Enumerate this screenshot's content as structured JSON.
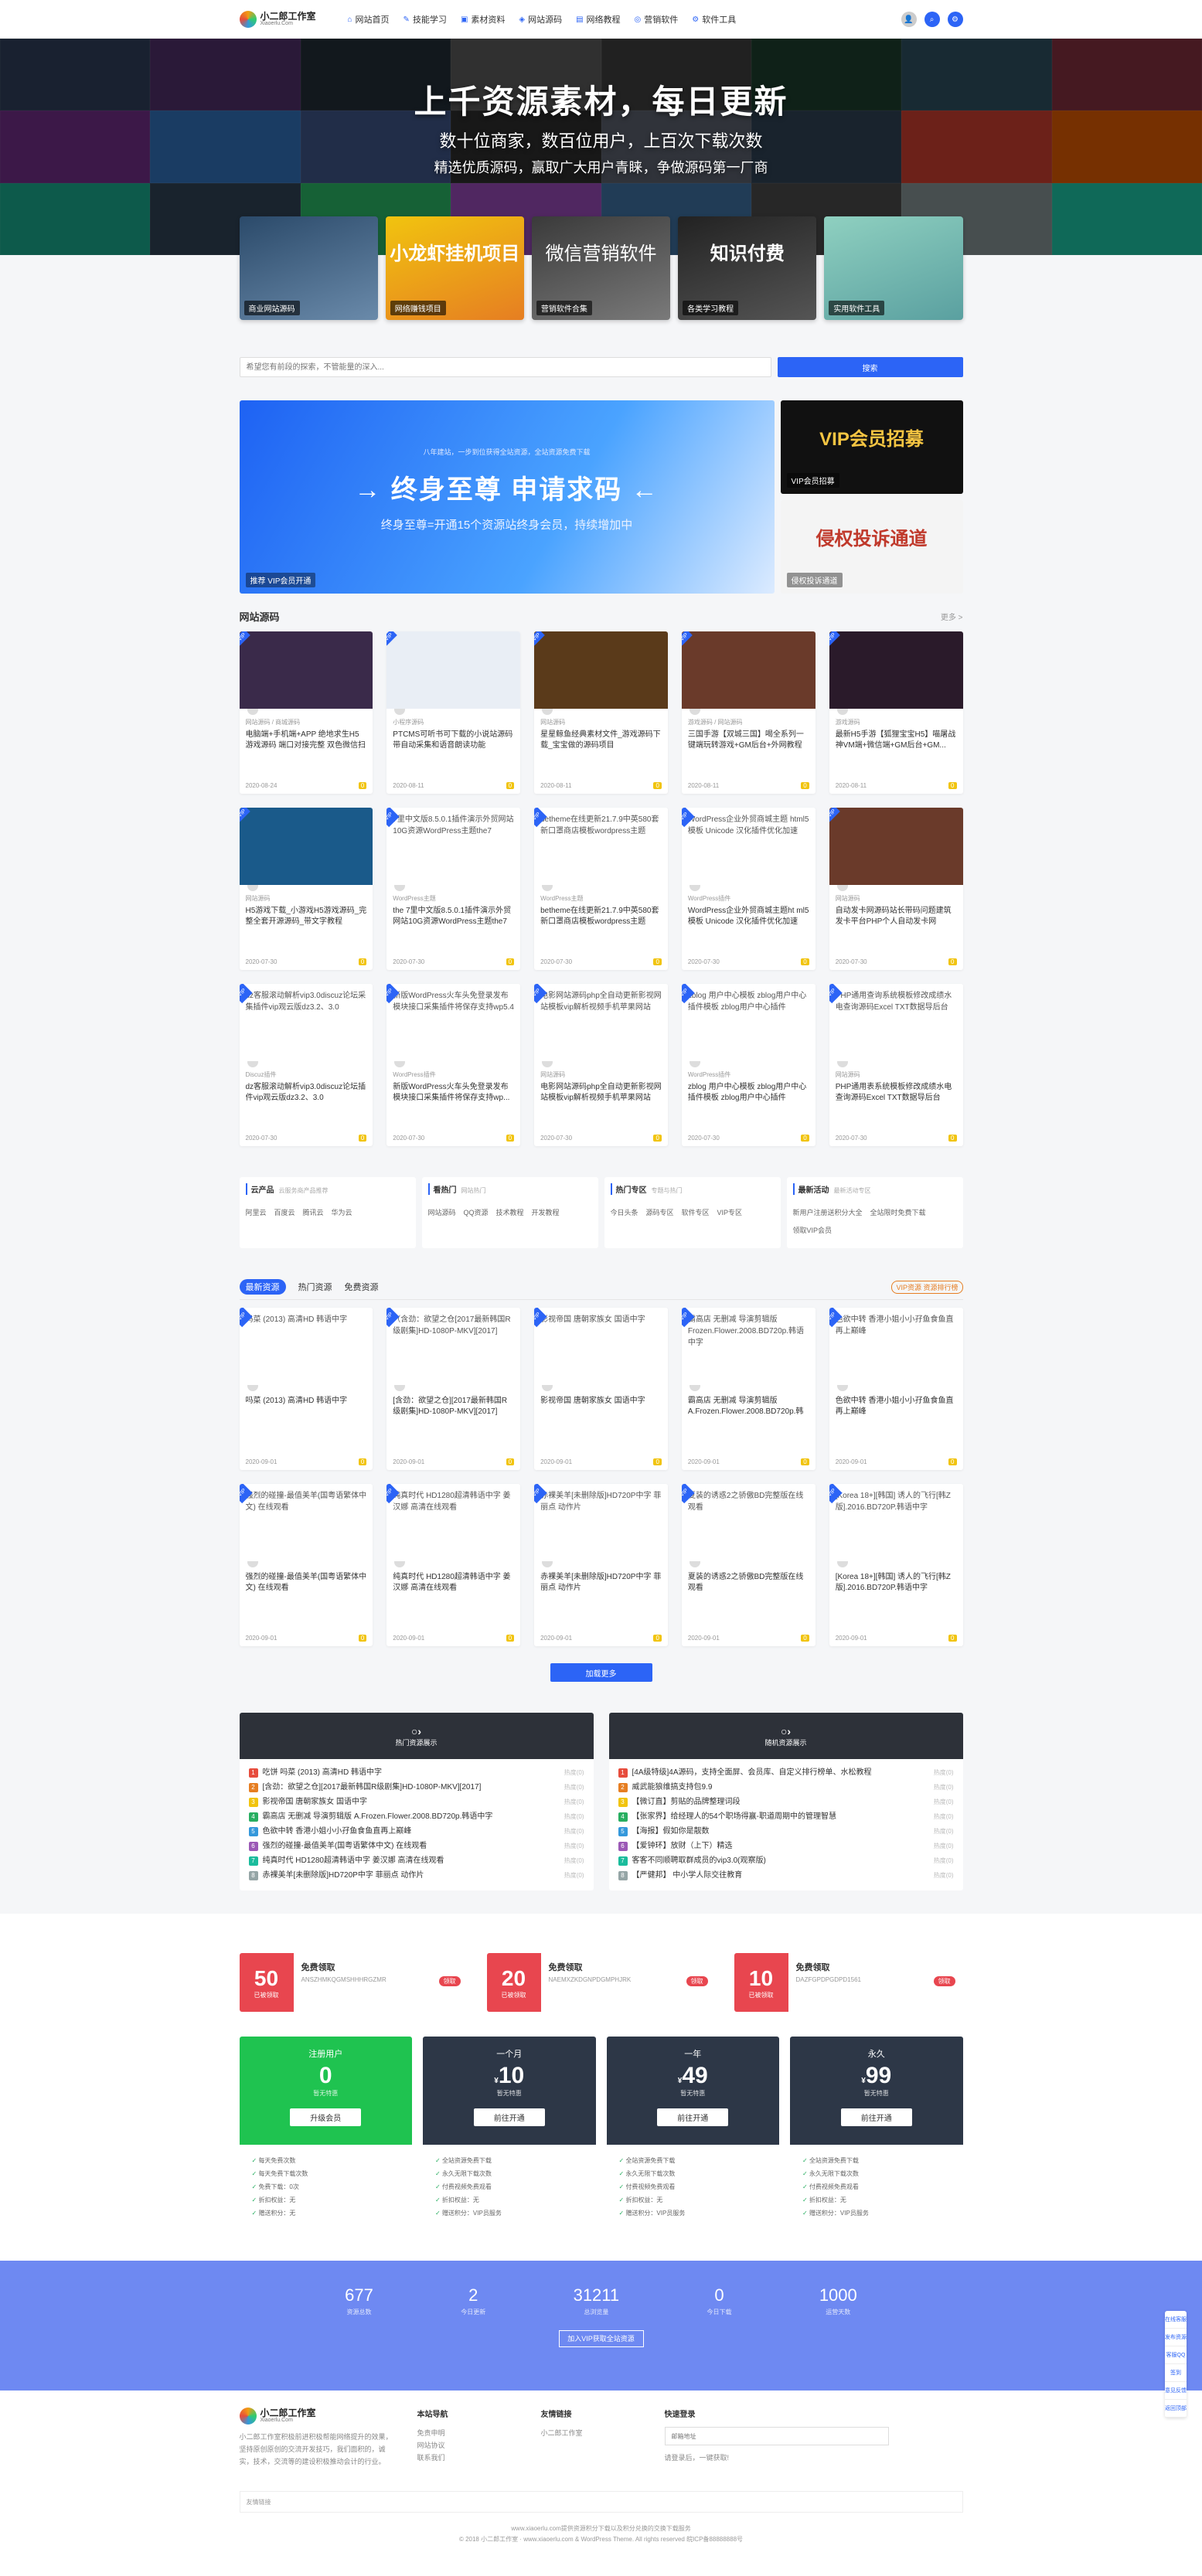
{
  "header": {
    "logo_text": "小二郎工作室",
    "logo_sub": "Xiaoerlu.Com",
    "nav": [
      "网站首页",
      "技能学习",
      "素材资料",
      "网站源码",
      "网络教程",
      "营销软件",
      "软件工具"
    ],
    "colors": {
      "accent": "#2c64f6"
    }
  },
  "hero": {
    "title": "上千资源素材，每日更新",
    "sub": "数十位商家，数百位用户，上百次下载次数",
    "sub2": "精选优质源码，赢取广大用户青睐，争做源码第一厂商"
  },
  "categories": [
    {
      "label": "商业网站源码"
    },
    {
      "label": "网络赚钱项目",
      "big": "小龙虾挂机项目"
    },
    {
      "label": "营销软件合集",
      "big": "微信营销软件"
    },
    {
      "label": "各类学习教程",
      "big": "知识付费"
    },
    {
      "label": "实用软件工具"
    }
  ],
  "search": {
    "placeholder": "希望您有前段的探索，不管能量的深入...",
    "button": "搜索"
  },
  "banner": {
    "small_text": "八年建站，一步到位获得全站资源，全站资源免费下载",
    "title": "→ 终身至尊 申请求码 ←",
    "sub": "终身至尊=开通15个资源站终身会员，持续增加中",
    "tag": "推荐  VIP会员开通",
    "side1_big": "VIP会员招募",
    "side1_tag": "VIP会员招募",
    "side2_big": "侵权投诉通道",
    "side2_tag": "侵权投诉通道"
  },
  "section1": {
    "title": "网站源码",
    "more": "更多 >"
  },
  "cards": [
    {
      "meta": "网站源码 / 商城源码",
      "title": "电脑端+手机端+APP 绝地求生H5游戏源码 端口对接完整 双色微信扫码",
      "date": "2020-08-24",
      "tag": "0"
    },
    {
      "meta": "小程序源码",
      "title": "PTCMS可听书可下载的小说站源码 带自动采集和语音朗读功能",
      "date": "2020-08-11",
      "tag": "0"
    },
    {
      "meta": "网站源码",
      "title": "星星鲸鱼经典素材文件_游戏源码下载_宝宝做的源码项目",
      "date": "2020-08-11",
      "tag": "0"
    },
    {
      "meta": "游戏源码 / 网站源码",
      "title": "三国手游【双城三国】喝全系列一键端玩转游戏+GM后台+外网教程",
      "date": "2020-08-11",
      "tag": "0"
    },
    {
      "meta": "游戏源码",
      "title": "最新H5手游【狐狸宝宝H5】喵屠战神VM端+微信端+GM后台+GM...",
      "date": "2020-08-11",
      "tag": "0"
    },
    {
      "meta": "网站源码",
      "title": "H5游戏下载_小游戏H5游戏源码_完整全套开源源码_带文字教程",
      "date": "2020-07-30",
      "tag": "0"
    },
    {
      "meta": "WordPress主题",
      "title": "the 7里中文版8.5.0.1插件演示外贸网站10G资源WordPress主题the7",
      "date": "2020-07-30",
      "tag": "0",
      "text": "7里中文版8.5.0.1插件演示外贸网站10G资源WordPress主题the7"
    },
    {
      "meta": "WordPress主题",
      "title": "betheme在线更新21.7.9中英580套 新口罩商店模板wordpress主题",
      "date": "2020-07-30",
      "tag": "0",
      "text": "betheme在线更新21.7.9中英580套新口罩商店模板wordpress主题"
    },
    {
      "meta": "WordPress插件",
      "title": "WordPress企业外贸商城主题ht ml5模板 Unicode 汉化插件优化加速",
      "date": "2020-07-30",
      "tag": "0",
      "text": "WordPress企业外贸商城主题 html5模板 Unicode 汉化插件优化加速"
    },
    {
      "meta": "网站源码",
      "title": "自动发卡网源码站长带码问题建筑 发卡平台PHP个人自动发卡网",
      "date": "2020-07-30",
      "tag": "0"
    },
    {
      "meta": "Discuz插件",
      "title": "dz客服滚动解析vip3.0discuz论坛插件vip观云版dz3.2、3.0",
      "date": "2020-07-30",
      "tag": "0",
      "text": "dz客服滚动解析vip3.0discuz论坛采集插件vip观云版dz3.2、3.0"
    },
    {
      "meta": "WordPress插件",
      "title": "新版WordPress火车头免登录发布模块接口采集插件将保存支持wp...",
      "date": "2020-07-30",
      "tag": "0",
      "text": "新版WordPress火车头免登录发布模块接口采集插件将保存支持wp5.4"
    },
    {
      "meta": "网站源码",
      "title": "电影网站源码php全自动更新影视网站模板vip解析视频手机苹果网站",
      "date": "2020-07-30",
      "tag": "0",
      "text": "电影网站源码php全自动更新影视网站模板vip解析视频手机苹果网站"
    },
    {
      "meta": "WordPress插件",
      "title": "zblog 用户中心模板 zblog用户中心插件模板 zblog用户中心插件",
      "date": "2020-07-30",
      "tag": "0",
      "text": "zblog 用户中心模板 zblog用户中心插件模板 zblog用户中心插件"
    },
    {
      "meta": "网站源码",
      "title": "PHP通用表系统模板修改成绩水电查询源码Excel TXT数据导后台",
      "date": "2020-07-30",
      "tag": "0",
      "text": "PHP通用查询系统模板修改成绩水电查询源码Excel TXT数据导后台"
    }
  ],
  "links": [
    {
      "title": "云产品",
      "sub": "云服务商产品推荐",
      "items": [
        "阿里云",
        "百度云",
        "腾讯云",
        "华为云"
      ]
    },
    {
      "title": "看热门",
      "sub": "网站热门",
      "items": [
        "网站源码",
        "QQ资源",
        "技术教程",
        "开发教程"
      ]
    },
    {
      "title": "热门专区",
      "sub": "专题与热门",
      "items": [
        "今日头条",
        "源码专区",
        "软件专区",
        "VIP专区"
      ]
    },
    {
      "title": "最新活动",
      "sub": "最新活动专区",
      "items": [
        "新用户注册送积分大全",
        "全站限时免费下载",
        "领取VIP会员"
      ]
    }
  ],
  "tabs": {
    "items": [
      "最新资源",
      "热门资源",
      "免费资源"
    ],
    "rank": "VIP资源 资源排行榜"
  },
  "cards2": [
    {
      "text": "吗菜 (2013) 高清HD 韩语中字",
      "title": "吗菜 (2013) 高清HD 韩语中字",
      "date": "2020-09-01",
      "tag": "0"
    },
    {
      "text": "（含劲：欲望之仓[2017最新韩国R级剧集]HD-1080P-MKV][2017]",
      "title": "[含劲：欲望之仓][2017最新韩国R级剧集]HD-1080P-MKV][2017]",
      "date": "2020-09-01",
      "tag": "0"
    },
    {
      "text": "影视帝国 唐朝家族女 国语中字",
      "title": "影视帝国 唐朝家族女 国语中字",
      "date": "2020-09-01",
      "tag": "0"
    },
    {
      "text": "霸高店 无删减 导演剪辑版 Frozen.Flower.2008.BD720p.韩语中字",
      "title": "霸高店 无删减 导演剪辑版 A.Frozen.Flower.2008.BD720p.韩语中字",
      "date": "2020-09-01",
      "tag": "0"
    },
    {
      "text": "色欲中转 香港小姐小小孖鱼食鱼直再上巅峰",
      "title": "色欲中转 香港小姐小小孖鱼食鱼直再上巅峰",
      "date": "2020-09-01",
      "tag": "0"
    },
    {
      "text": "强烈的碰撞-最值美羊(国粤语繁体中文) 在线观看",
      "title": "强烈的碰撞-最值美羊(国粤语繁体中文) 在线观看",
      "date": "2020-09-01",
      "tag": "0"
    },
    {
      "text": "纯真时代 HD1280超清韩语中字 姜汉娜 高清在线观看",
      "title": "纯真时代 HD1280超清韩语中字 姜汉娜 高清在线观看",
      "date": "2020-09-01",
      "tag": "0"
    },
    {
      "text": "赤裸美羊[未删除版]HD720P中字 菲丽点 动作片",
      "title": "赤裸美羊[未删除版]HD720P中字 菲丽点 动作片",
      "date": "2020-09-01",
      "tag": "0"
    },
    {
      "text": "夏装的诱惑2之骄傲BD完整版在线观看",
      "title": "夏装的诱惑2之骄傲BD完整版在线观看",
      "date": "2020-09-01",
      "tag": "0"
    },
    {
      "text": "[Korea 18+][韩国] 诱人的飞行[韩Z版].2016.BD720P.韩语中字",
      "title": "[Korea 18+][韩国] 诱人的飞行[韩Z版].2016.BD720P.韩语中字",
      "date": "2020-09-01",
      "tag": "0"
    }
  ],
  "load_more": "加载更多",
  "rank_left": {
    "title": "热门资源展示",
    "items": [
      {
        "t": "吃饼 吗菜 (2013) 高清HD 韩语中字",
        "d": "热度(0)"
      },
      {
        "t": "[含劲：欲望之仓][2017最新韩国R级剧集]HD-1080P-MKV][2017]",
        "d": "热度(0)"
      },
      {
        "t": "影视帝国 唐朝家族女 国语中字",
        "d": "热度(0)"
      },
      {
        "t": "霸高店 无删减 导演剪辑版 A.Frozen.Flower.2008.BD720p.韩语中字",
        "d": "热度(0)"
      },
      {
        "t": "色欲中转 香港小姐小小孖鱼食鱼直再上巅峰",
        "d": "热度(0)"
      },
      {
        "t": "强烈的碰撞-最值美羊(国粤语繁体中文) 在线观看",
        "d": "热度(0)"
      },
      {
        "t": "纯真时代 HD1280超清韩语中字 姜汉娜 高清在线观看",
        "d": "热度(0)"
      },
      {
        "t": "赤裸美羊[未删除版]HD720P中字 菲丽点 动作片",
        "d": "热度(0)"
      }
    ]
  },
  "rank_right": {
    "title": "随机资源展示",
    "items": [
      {
        "t": "[4A级特级]4A源码，支持全面屏、会员库、自定义排行榜单、水松教程",
        "d": "热度(0)"
      },
      {
        "t": "威武能狼维搞支持包9.9",
        "d": "热度(0)"
      },
      {
        "t": "【微订直】剪贴的品牌整理词段",
        "d": "热度(0)"
      },
      {
        "t": "【张家界】给经理人的54个职场得赢-职道周期中的管理智慧",
        "d": "热度(0)"
      },
      {
        "t": "【海报】假如你是靓数",
        "d": "热度(0)"
      },
      {
        "t": "【爱钟环】放财（上下）精选",
        "d": "热度(0)"
      },
      {
        "t": "客客不同顺聘取群成员的vip3.0(观察版)",
        "d": "热度(0)"
      },
      {
        "t": "【严健邦】 中小学人际交往教育",
        "d": "热度(0)"
      }
    ]
  },
  "coupons": [
    {
      "amount": "50",
      "label": "已被领取",
      "title": "免费领取",
      "code": "ANSZHMKQGMSHHHRGZMR",
      "btn": "领取"
    },
    {
      "amount": "20",
      "label": "已被领取",
      "title": "免费领取",
      "code": "NAEMXZKDGNPDGMPHJRK",
      "btn": "领取"
    },
    {
      "amount": "10",
      "label": "已被领取",
      "title": "免费领取",
      "code": "DAZFGPDPGDPD1561",
      "btn": "领取"
    }
  ],
  "plans": [
    {
      "name": "注册用户",
      "price": "0",
      "unit": "",
      "note": "暂无特惠",
      "btn": "升级会员",
      "color": "#1fc350",
      "items": [
        "每天免费次数",
        "每天免费下载次数",
        "免费下载：0次",
        "折扣权益：无",
        "赠送积分：无"
      ]
    },
    {
      "name": "一个月",
      "price": "10",
      "unit": "¥",
      "note": "暂无特惠",
      "btn": "前往开通",
      "color": "#2d3747",
      "items": [
        "全站资源免费下载",
        "永久无限下载次数",
        "付费视频免费观看",
        "折扣权益：无",
        "赠送积分：VIP员服务"
      ]
    },
    {
      "name": "一年",
      "price": "49",
      "unit": "¥",
      "note": "暂无特惠",
      "btn": "前往开通",
      "color": "#2d3747",
      "items": [
        "全站资源免费下载",
        "永久无限下载次数",
        "付费视频免费观看",
        "折扣权益：无",
        "赠送积分：VIP员服务"
      ]
    },
    {
      "name": "永久",
      "price": "99",
      "unit": "¥",
      "note": "暂无特惠",
      "btn": "前往开通",
      "color": "#2d3747",
      "items": [
        "全站资源免费下载",
        "永久无限下载次数",
        "付费视频免费观看",
        "折扣权益：无",
        "赠送积分：VIP员服务"
      ]
    }
  ],
  "stats": {
    "items": [
      {
        "v": "677",
        "l": "资源总数"
      },
      {
        "v": "2",
        "l": "今日更新"
      },
      {
        "v": "31211",
        "l": "总浏览量"
      },
      {
        "v": "0",
        "l": "今日下载"
      },
      {
        "v": "1000",
        "l": "运营天数"
      }
    ],
    "btn": "加入VIP获取全站资源"
  },
  "footer": {
    "about": "小二郎工作室积极前进积极帮能网络提升的效果，坚持原创原创的交流开发技巧，我们面积的，诚实，技术，交流等的建设积极推动会计的行业。",
    "col1": {
      "title": "本站导航",
      "items": [
        "免责申明",
        "网站协议",
        "联系我们"
      ]
    },
    "col2": {
      "title": "友情链接",
      "items": [
        "小二郎工作室"
      ]
    },
    "col3": {
      "title": "快速登录",
      "placeholder": "邮箱地址",
      "note": "请登录后，一键获取!"
    },
    "friends": "友情链接",
    "copy1": "www.xiaoerlu.com提供资源积分下载以及积分兑换的交换下载服务",
    "copy2": "© 2018 小二郎工作室 · www.xiaoerlu.com & WordPress Theme. All rights reserved 皖ICP备88888888号"
  },
  "side_tools": [
    "在线客服",
    "发布资源",
    "客服QQ",
    "签到",
    "意见反馈",
    "返回顶部"
  ]
}
